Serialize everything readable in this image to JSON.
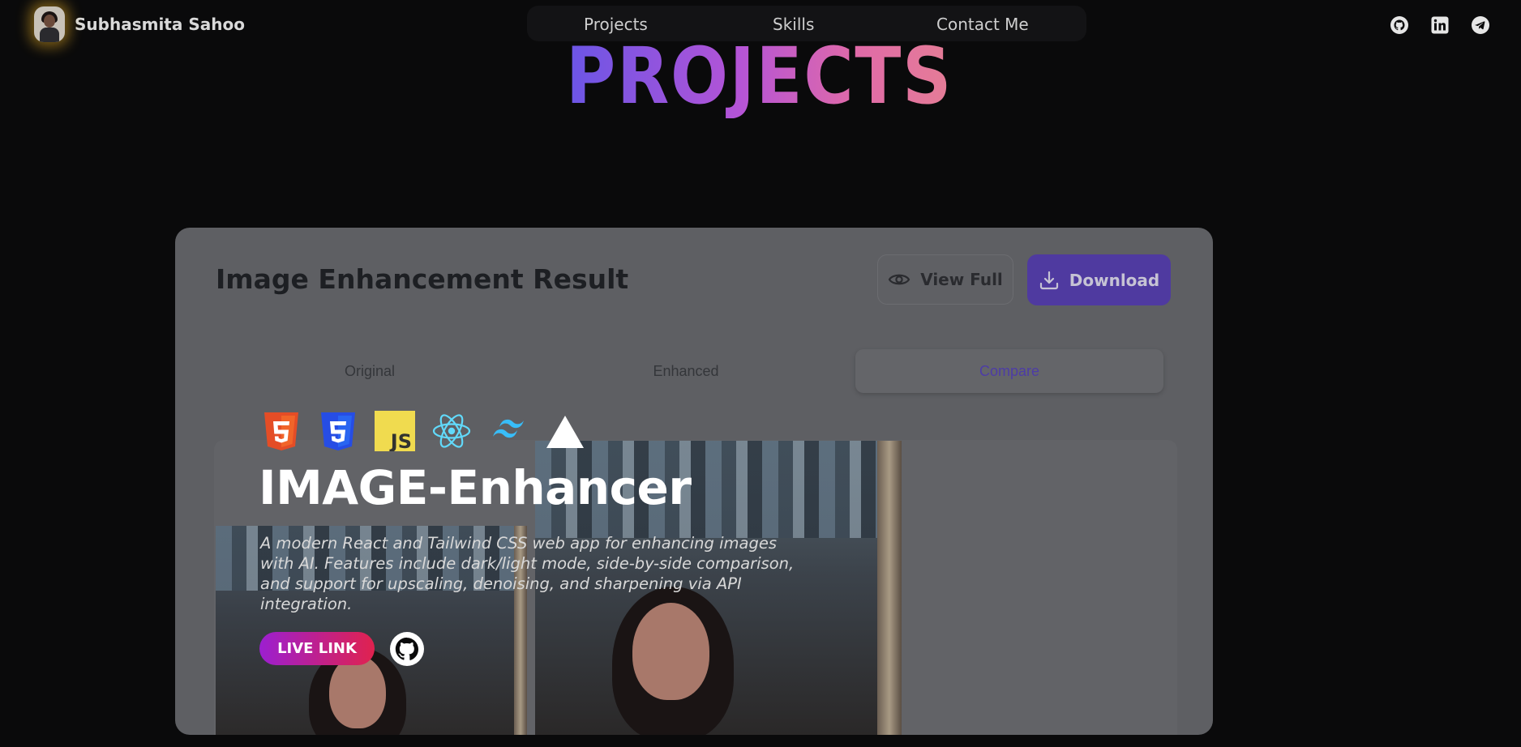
{
  "header": {
    "brand_name": "Subhasmita Sahoo",
    "nav": [
      {
        "label": "Projects"
      },
      {
        "label": "Skills"
      },
      {
        "label": "Contact Me"
      }
    ],
    "socials": [
      "github-icon",
      "linkedin-icon",
      "telegram-icon"
    ]
  },
  "page_title": "PROJECTS",
  "card": {
    "title": "Image Enhancement Result",
    "view_full_label": "View Full",
    "download_label": "Download",
    "tabs": [
      {
        "label": "Original"
      },
      {
        "label": "Enhanced"
      },
      {
        "label": "Compare",
        "active": true
      }
    ]
  },
  "project": {
    "tech_icons": [
      "html5-icon",
      "css3-icon",
      "javascript-icon",
      "react-icon",
      "tailwind-icon",
      "vercel-icon"
    ],
    "name": "IMAGE-Enhancer",
    "description": "A modern React and Tailwind CSS web app for enhancing images with AI. Features include dark/light mode, side-by-side comparison, and support for upscaling, denoising, and sharpening via API integration.",
    "live_link_label": "LIVE LINK"
  },
  "colors": {
    "accent_purple": "#4f3aa0",
    "title_gradient_start": "#6a55e6",
    "title_gradient_end": "#e57d96",
    "live_link_gradient_start": "#9c1fd0",
    "live_link_gradient_end": "#e0224e"
  }
}
